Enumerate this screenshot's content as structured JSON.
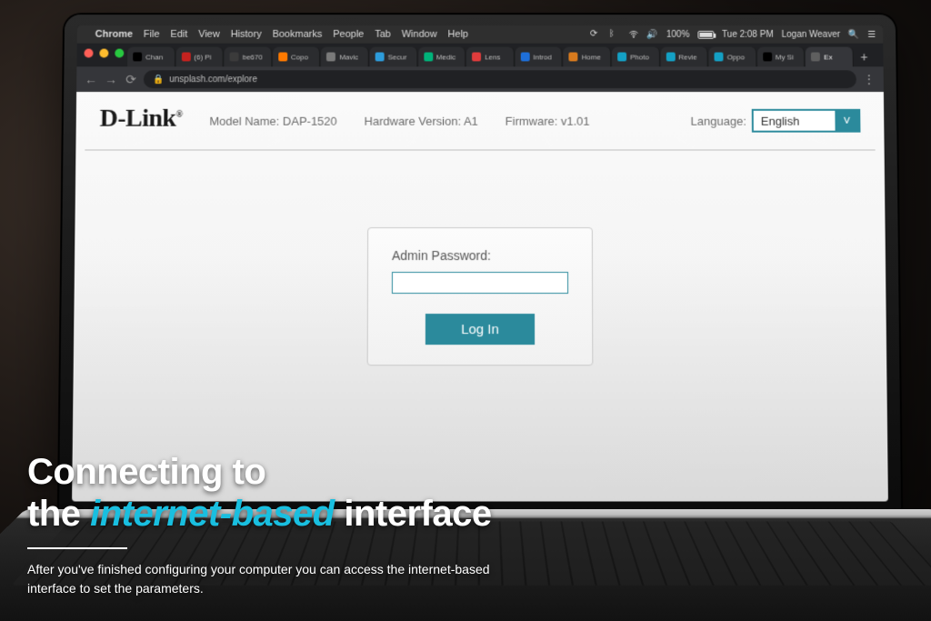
{
  "mac_menubar": {
    "app": "Chrome",
    "menus": [
      "File",
      "Edit",
      "View",
      "History",
      "Bookmarks",
      "People",
      "Tab",
      "Window",
      "Help"
    ],
    "battery_pct": "100%",
    "clock": "Tue 2:08 PM",
    "user": "Logan Weaver"
  },
  "chrome": {
    "url": "unsplash.com/explore",
    "tabs": [
      {
        "fav": "#000000",
        "label": "Chan"
      },
      {
        "fav": "#c5221f",
        "label": "(6) Pi"
      },
      {
        "fav": "#3b3b3b",
        "label": "be670"
      },
      {
        "fav": "#ff7a00",
        "label": "Copo"
      },
      {
        "fav": "#7a7a7a",
        "label": "Mavic"
      },
      {
        "fav": "#2d9cdb",
        "label": "Secur"
      },
      {
        "fav": "#00b37a",
        "label": "Medic"
      },
      {
        "fav": "#e03c3c",
        "label": "Lens"
      },
      {
        "fav": "#1e6fd9",
        "label": "Introd"
      },
      {
        "fav": "#d97b1e",
        "label": "Home"
      },
      {
        "fav": "#14a0c4",
        "label": "Photo"
      },
      {
        "fav": "#14a0c4",
        "label": "Revie"
      },
      {
        "fav": "#14a0c4",
        "label": "Oppo"
      },
      {
        "fav": "#000000",
        "label": "My Si"
      },
      {
        "fav": "#5f5f5f",
        "label": "Ex",
        "active": true
      }
    ]
  },
  "dlink": {
    "logo_text": "D-Link",
    "model_label": "Model Name:",
    "model_value": "DAP-1520",
    "hw_label": "Hardware Version:",
    "hw_value": "A1",
    "fw_label": "Firmware:",
    "fw_value": "v1.01",
    "lang_label": "Language:",
    "lang_value": "English",
    "login": {
      "password_label": "Admin Password:",
      "password_value": "",
      "button_label": "Log In"
    }
  },
  "caption": {
    "line1": "Connecting to",
    "line2a": "the ",
    "accent": "internet-based",
    "line2b": " interface",
    "body": "After you've finished configuring your computer you can access the internet-based interface to set the parameters."
  }
}
